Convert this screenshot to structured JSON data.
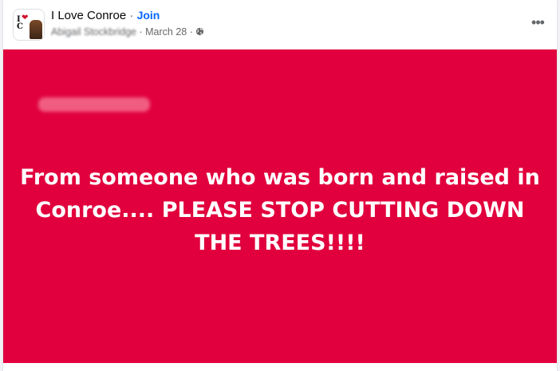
{
  "post": {
    "group_name": "I Love Conroe",
    "separator": " · ",
    "join_label": "Join",
    "author": "Abigail Stockbridge",
    "date": "March 28",
    "privacy_icon": "globe-icon",
    "more_icon": "more-options-icon",
    "more_label": "•••",
    "banner_color": "#e1003d",
    "banner_text": "From someone who was born and raised in Conroe.... PLEASE STOP CUTTING DOWN THE TREES!!!!"
  }
}
